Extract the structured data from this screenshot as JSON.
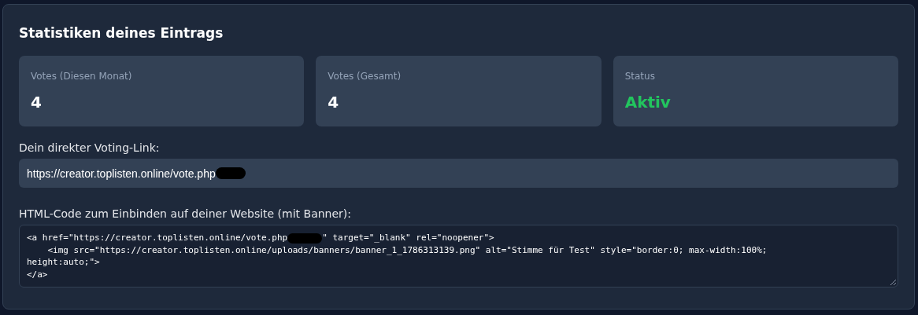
{
  "title": "Statistiken deines Eintrags",
  "cards": [
    {
      "kind": "number",
      "label": "Votes (Diesen Monat)",
      "value": "4"
    },
    {
      "kind": "number",
      "label": "Votes (Gesamt)",
      "value": "4"
    },
    {
      "kind": "status",
      "label": "Status",
      "value": "Aktiv"
    }
  ],
  "voting_link": {
    "label": "Dein direkter Voting-Link:",
    "value": "https://creator.toplisten.online/vote.php",
    "redacted": true
  },
  "embed_code": {
    "label": "HTML-Code zum Einbinden auf deiner Website (mit Banner):",
    "lines": [
      {
        "text": "<a href=\"https://creator.toplisten.online/vote.php",
        "redacted": true,
        "rest": "\" target=\"_blank\" rel=\"noopener\">"
      },
      {
        "text": "    <img src=\"https://creator.toplisten.online/uploads/banners/banner_1_1786313139.png\" alt=\"Stimme für Test\" style=\"border:0; max-width:100%;",
        "redacted": false
      },
      {
        "text": "height:auto;\">",
        "redacted": false
      },
      {
        "text": "</a>",
        "redacted": false
      }
    ]
  }
}
